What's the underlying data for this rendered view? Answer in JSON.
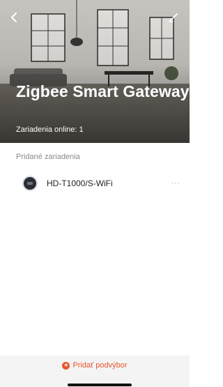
{
  "header": {
    "back_icon": "chevron-left-icon",
    "edit_icon": "pencil-icon",
    "title": "Zigbee Smart Gateway",
    "online_status": "Zariadenia online: 1"
  },
  "devices": {
    "section_label": "Pridané zariadenia",
    "items": [
      {
        "name": "HD-T1000/S-WiFi",
        "icon": "thermostat-icon",
        "more": "···"
      }
    ]
  },
  "footer": {
    "add_label": "Pridať podvýbor",
    "add_icon": "plus-circle-icon",
    "accent_color": "#e8542b"
  }
}
